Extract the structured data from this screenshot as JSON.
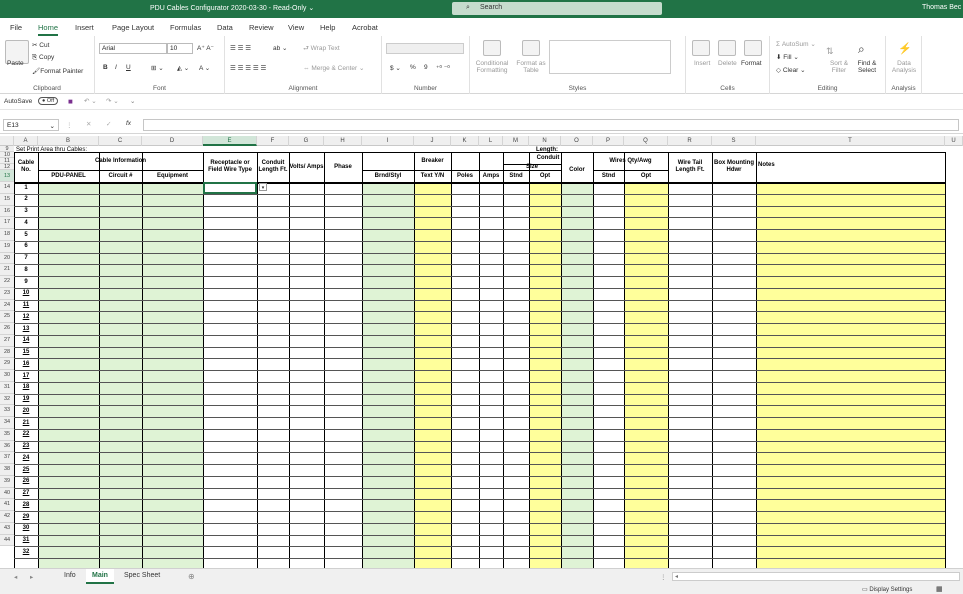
{
  "titlebar": {
    "title": "PDU Cables Configurator 2020-03-30  -  Read-Only",
    "dropdown": "⌄",
    "search_placeholder": "Search",
    "user": "Thomas Bec"
  },
  "menu": {
    "tabs": [
      "File",
      "Home",
      "Insert",
      "Page Layout",
      "Formulas",
      "Data",
      "Review",
      "View",
      "Help",
      "Acrobat"
    ]
  },
  "ribbon": {
    "clipboard": {
      "paste": "Paste",
      "cut": "Cut",
      "copy": "Copy",
      "format_painter": "Format Painter",
      "label": "Clipboard"
    },
    "font": {
      "name": "Arial",
      "size": "10",
      "bold": "B",
      "italic": "I",
      "underline": "U",
      "label": "Font"
    },
    "alignment": {
      "wrap": "Wrap Text",
      "merge": "Merge & Center",
      "label": "Alignment"
    },
    "number": {
      "currency": "$",
      "percent": "%",
      "comma": "9",
      "label": "Number"
    },
    "styles": {
      "conditional": "Conditional Formatting",
      "format_table": "Format as Table",
      "label": "Styles"
    },
    "cells": {
      "insert": "Insert",
      "delete": "Delete",
      "format": "Format",
      "label": "Cells"
    },
    "editing": {
      "autosum": "AutoSum",
      "fill": "Fill",
      "clear": "Clear",
      "sort": "Sort & Filter",
      "find": "Find & Select",
      "label": "Editing"
    },
    "analysis": {
      "data_analysis": "Data Analysis",
      "label": "Analysis"
    }
  },
  "qat": {
    "autosave": "AutoSave",
    "toggle": "Off"
  },
  "formula_bar": {
    "cell_ref": "E13",
    "fx": "fx",
    "cancel": "✕",
    "enter": "✓",
    "value": ""
  },
  "sheet": {
    "columns": [
      "A",
      "B",
      "C",
      "D",
      "E",
      "F",
      "G",
      "H",
      "I",
      "J",
      "K",
      "L",
      "M",
      "N",
      "O",
      "P",
      "Q",
      "R",
      "S",
      "T"
    ],
    "selected_column": "E",
    "selected_row": "13",
    "rows": [
      "9",
      "10",
      "11",
      "12",
      "13",
      "14",
      "15",
      "16",
      "17",
      "18",
      "19",
      "20",
      "21",
      "22",
      "23",
      "24",
      "25",
      "26",
      "27",
      "28",
      "29",
      "30",
      "31",
      "32",
      "33",
      "34",
      "35",
      "36",
      "37",
      "38",
      "39",
      "40",
      "41",
      "42",
      "43",
      "44"
    ],
    "note_row": "Set Print Area thru Cables:",
    "length_label": "Length:",
    "headers": {
      "cable_no": "Cable No.",
      "cable_info": "Cable Information",
      "pdu_panel": "PDU-PANEL",
      "circuit": "Circuit #",
      "equipment": "Equipment",
      "receptacle": "Receptacle or Field Wire Type",
      "conduit_length": "Conduit Length Ft.",
      "volts_amps": "Volts/ Amps",
      "phase": "Phase",
      "breaker": "Breaker",
      "brnd": "Brnd/Styl",
      "text_yn": "Text Y/N",
      "poles": "Poles",
      "amps": "Amps",
      "conduit": "Conduit",
      "size": "Size",
      "stnd": "Stnd",
      "opt": "Opt",
      "color": "Color",
      "wires": "Wires Qty/Awg",
      "wire_stnd": "Stnd",
      "wire_opt": "Opt",
      "wire_tail": "Wire Tail Length Ft.",
      "box_mount": "Box Mounting Hdwr",
      "notes": "Notes"
    },
    "cable_numbers": [
      "1",
      "2",
      "3",
      "4",
      "5",
      "6",
      "7",
      "8",
      "9",
      "10",
      "11",
      "12",
      "13",
      "14",
      "15",
      "16",
      "17",
      "18",
      "19",
      "20",
      "21",
      "22",
      "23",
      "24",
      "25",
      "26",
      "27",
      "28",
      "29",
      "30",
      "31",
      "32"
    ]
  },
  "sheet_tabs": [
    "Info",
    "Main",
    "Spec Sheet"
  ],
  "active_tab": "Main",
  "status": {
    "display_settings": "Display Settings"
  },
  "colors": {
    "excel_green": "#217346",
    "cell_green": "#dff3d5",
    "cell_yellow": "#ffff9b"
  }
}
